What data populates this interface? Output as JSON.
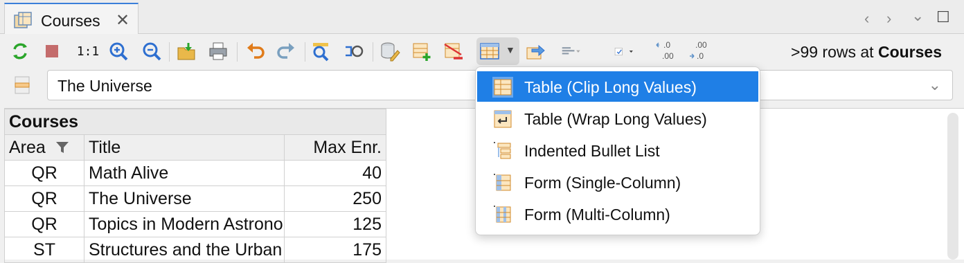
{
  "tab": {
    "title": "Courses",
    "close": "✕"
  },
  "window_controls": {
    "back": "‹",
    "forward": "›",
    "menu": "⌄",
    "maximize": "☐"
  },
  "toolbar": {
    "zoom_reset_label": "1:1",
    "rows_count": ">99 rows at ",
    "rows_table": "Courses",
    "icons": [
      "refresh-icon",
      "stop-icon",
      "zoom-reset-icon",
      "zoom-in-icon",
      "zoom-out-icon",
      "export-icon",
      "print-icon",
      "undo-icon",
      "redo-icon",
      "find-icon",
      "find-reference-icon",
      "data-source-icon",
      "add-row-icon",
      "delete-row-icon",
      "view-mode-icon",
      "navigate-icon",
      "align-icon",
      "checkbox-icon",
      "decrease-decimals-icon",
      "increase-decimals-icon"
    ],
    "decimal_left": [
      ".0",
      ".00"
    ],
    "decimal_right": [
      ".00",
      ".0"
    ]
  },
  "path": {
    "value": "The Universe"
  },
  "grid": {
    "caption": "Courses",
    "columns": [
      "Area",
      "Title",
      "Max Enr."
    ],
    "rows": [
      [
        "QR",
        "Math Alive",
        "40"
      ],
      [
        "QR",
        "The Universe",
        "250"
      ],
      [
        "QR",
        "Topics in Modern Astronomy",
        "125"
      ],
      [
        "ST",
        "Structures and the Urban Environment",
        "175"
      ]
    ]
  },
  "view_menu": {
    "items": [
      {
        "label": "Table (Clip Long Values)",
        "icon": "table-clip-icon",
        "selected": true
      },
      {
        "label": "Table (Wrap Long Values)",
        "icon": "table-wrap-icon",
        "selected": false
      },
      {
        "label": "Indented Bullet List",
        "icon": "bullet-list-icon",
        "selected": false
      },
      {
        "label": "Form (Single-Column)",
        "icon": "form-single-icon",
        "selected": false
      },
      {
        "label": "Form (Multi-Column)",
        "icon": "form-multi-icon",
        "selected": false
      }
    ]
  },
  "colors": {
    "accent": "#1f7fe6",
    "tab_border": "#3a7fd9",
    "icon_green": "#2aa52a",
    "icon_blue": "#2e6fd0",
    "icon_orange": "#e39a2a"
  }
}
